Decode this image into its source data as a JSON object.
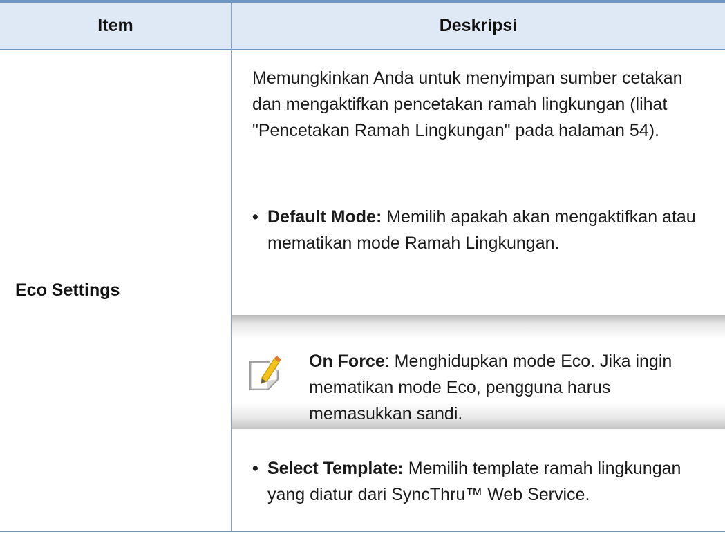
{
  "table": {
    "header": {
      "item": "Item",
      "description": "Deskripsi"
    },
    "row": {
      "item": "Eco Settings",
      "intro": "Memungkinkan Anda untuk menyimpan sumber cetakan dan mengaktifkan pencetakan ramah lingkungan (lihat \"Pencetakan Ramah Lingkungan\" pada halaman 54).",
      "bullet_1": {
        "label": "Default Mode:",
        "text": " Memilih apakah akan mengaktifkan atau mematikan mode Ramah Lingkungan."
      },
      "note": {
        "icon": "note-pencil-icon",
        "label": "On Force",
        "text": ": Menghidupkan mode Eco. Jika ingin mematikan mode Eco, pengguna harus memasukkan sandi."
      },
      "bullet_2": {
        "label": "Select Template:",
        "text": " Memilih template ramah lingkungan yang diatur dari SyncThru™ Web Service."
      }
    }
  },
  "colors": {
    "rule": "#6e96c2",
    "header_bg": "#dfe9f5",
    "note_shade": "#b8b8b8"
  }
}
